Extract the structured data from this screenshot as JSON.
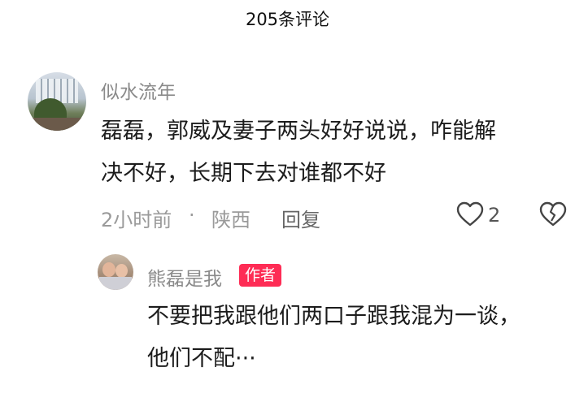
{
  "header": {
    "title": "205条评论"
  },
  "comments": [
    {
      "username": "似水流年",
      "text_line1": "磊磊，郭威及妻子两头好好说说，咋能解",
      "text_line2": "决不好，长期下去对谁都不好",
      "time": "2小时前",
      "separator": "·",
      "location": "陕西",
      "reply_label": "回复",
      "like_count": "2",
      "like_icon": "heart-outline-icon",
      "dislike_icon": "broken-heart-icon"
    }
  ],
  "reply": {
    "username": "熊磊是我",
    "badge": "作者",
    "text_line1": "不要把我跟他们两口子跟我混为一谈，",
    "text_line2": "他们不配···"
  },
  "colors": {
    "badge": "#fe2c55",
    "meta": "#9a9a9a"
  }
}
